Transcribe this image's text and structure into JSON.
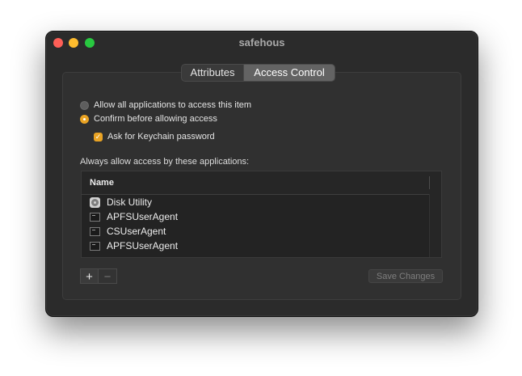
{
  "window": {
    "title": "safehous"
  },
  "tabs": [
    {
      "label": "Attributes",
      "active": false
    },
    {
      "label": "Access Control",
      "active": true
    }
  ],
  "access": {
    "allow_all_label": "Allow all applications to access this item",
    "allow_all_selected": false,
    "confirm_label": "Confirm before allowing access",
    "confirm_selected": true,
    "ask_password_label": "Ask for Keychain password",
    "ask_password_checked": true
  },
  "apps_section": {
    "label": "Always allow access by these applications:",
    "column_header": "Name",
    "items": [
      {
        "name": "Disk Utility",
        "icon": "disk-utility-icon"
      },
      {
        "name": "APFSUserAgent",
        "icon": "terminal-app-icon"
      },
      {
        "name": "CSUserAgent",
        "icon": "terminal-app-icon"
      },
      {
        "name": "APFSUserAgent",
        "icon": "terminal-app-icon"
      }
    ]
  },
  "buttons": {
    "add_label": "+",
    "remove_label": "−",
    "save_label": "Save Changes"
  },
  "colors": {
    "accent": "#e9a324",
    "window_bg": "#2b2b2b",
    "close": "#fe5f57",
    "minimize": "#febc2e",
    "maximize": "#28c840"
  }
}
